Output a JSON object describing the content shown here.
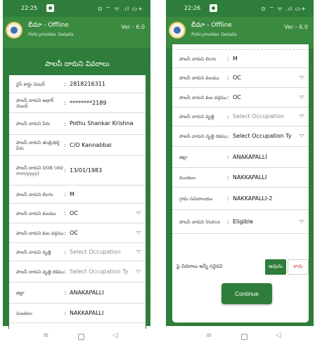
{
  "left": {
    "status": {
      "time": "22:25",
      "icons": "⊙ ⌔ ᯤ .ıl ▭+"
    },
    "app": {
      "title": "బీమా - Offline",
      "subtitle": "PolicyHolder Details",
      "version": "Ver - 6.0"
    },
    "card_title": "పాలసీ దారుని వివరాలు",
    "rows": [
      {
        "label": "రైస్ కార్డు నెంబర్",
        "value": "2818216311"
      },
      {
        "label": "పాలసీ దారుని ఆధార్ నెంబర్",
        "value": "********2189"
      },
      {
        "label": "పాలసీ దారుని పేరు",
        "value": "Pothu Shankar Krishna"
      },
      {
        "label": "పాలసీ దారుని తండ్రి/భర్త పేరు",
        "value": "C/O Kannabbai"
      },
      {
        "label": "పాలసీ దారుని DOB (dd/ mm/yyyy)",
        "value": "13/01/1983"
      },
      {
        "label": "పాలసీ దారుని లింగం",
        "value": "M"
      },
      {
        "label": "పాలసీ దారుని కులము",
        "value": "OC"
      },
      {
        "label": "పాలసీ దారుని కుల వర్గము",
        "value": "OC"
      },
      {
        "label": "పాలసీ దారుని వృత్తి",
        "value": "Select Occupation"
      },
      {
        "label": "పాలసీ దారుని వృత్తి రకము",
        "value": "Select Occupation Ty"
      },
      {
        "label": "జిల్లా",
        "value": "ANAKAPALLI"
      },
      {
        "label": "మండలం",
        "value": "NAKKAPALLI"
      }
    ]
  },
  "right": {
    "status": {
      "time": "22:26",
      "icons": "⊙ ⌔ ᯤ .ıl ▭+"
    },
    "app": {
      "title": "బీమా - Offline",
      "subtitle": "PolicyHolder Details",
      "version": "Ver - 6.0"
    },
    "rows": [
      {
        "label": "పాలసీ దారుని లింగం",
        "value": "M"
      },
      {
        "label": "పాలసీ దారుని కులము",
        "value": "OC"
      },
      {
        "label": "పాలసీ దారుని కుల వర్గము",
        "value": "OC"
      },
      {
        "label": "పాలసీ దారుని వృత్తి",
        "value": "Select Occupation"
      },
      {
        "label": "పాలసీ దారుని వృత్తి రకము",
        "value": "Select Occupation Ty"
      },
      {
        "label": "జిల్లా",
        "value": "ANAKAPALLI"
      },
      {
        "label": "మండలం",
        "value": "NAKKAPALLI"
      },
      {
        "label": "గ్రామ సచివాలయం",
        "value": "NAKKAPALLI-2"
      },
      {
        "label": "పాలసీ దారుని Status",
        "value": "Eligible"
      }
    ],
    "confirm_question": "పై వివరాలు అన్నీ సరైనవి",
    "yes_label": "అవును",
    "no_label": "కాదు",
    "continue_label": "Continue"
  },
  "colors": {
    "primary_green": "#2f7d3a",
    "no_red": "#d14a3a"
  }
}
